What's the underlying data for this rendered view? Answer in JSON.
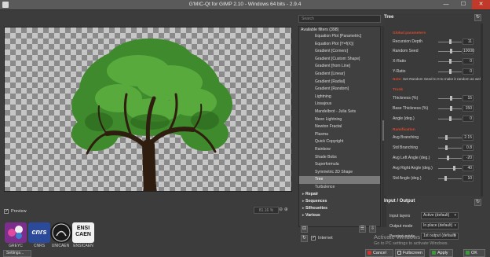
{
  "window": {
    "title": "G'MIC-Qt for GIMP 2.10 - Windows 64 bits - 2.9.4",
    "minimize": "—",
    "maximize": "☐",
    "close": "✕"
  },
  "preview": {
    "checkbox_label": "Preview",
    "checked": true,
    "zoom_value": "81.16 %",
    "zoom_buttons": "⊖ ⊕"
  },
  "logos": [
    {
      "label": "GREYC",
      "color": "#7b2e8c"
    },
    {
      "label": "CNRS",
      "color": "#2b4a9a"
    },
    {
      "label": "UNICAEN",
      "color": "#1a1a1a"
    },
    {
      "label": "ENSICAEN",
      "color": "#f2f2f2"
    }
  ],
  "logo_texts": {
    "enscaen_line1": "ENSI",
    "enscaen_line2": "CAEN",
    "cnrs": "cnrs"
  },
  "settings_button": "Settings...",
  "filters": {
    "search_placeholder": "Search",
    "header": "Available filters (398)",
    "items": [
      "Equation Plot [Parametric]",
      "Equation Plot [Y=f(X)]",
      "Gradient [Corners]",
      "Gradient [Custom Shape]",
      "Gradient [from Line]",
      "Gradient [Linear]",
      "Gradient [Radial]",
      "Gradient [Random]",
      "Lightning",
      "Lissajous",
      "Mandelbrot - Julia Sets",
      "Neon Lightning",
      "Newton Fractal",
      "Plasma",
      "Quick Copyright",
      "Rainbow",
      "Shade Bobs",
      "Superformula",
      "Symmetric 2D Shape",
      "Tree",
      "Turbulence"
    ],
    "selected": "Tree",
    "categories": [
      "Repair",
      "Sequences",
      "Silhouettes",
      "Various"
    ],
    "internet_label": "Internet",
    "internet_checked": true
  },
  "params": {
    "filter_title": "Tree",
    "sections": {
      "global": "Global parameters",
      "trunk": "Trunk",
      "ramification": "Ramification"
    },
    "rows": {
      "recursion_depth": {
        "label": "Recursion Depth",
        "value": "11",
        "level": 0.5
      },
      "random_seed": {
        "label": "Random Seed",
        "value": "10000",
        "level": 0.55
      },
      "x_ratio": {
        "label": "X-Ratio",
        "value": "0",
        "level": 0.5
      },
      "y_ratio": {
        "label": "Y-Ratio",
        "value": "0",
        "level": 0.5
      },
      "thickness": {
        "label": "Thickness (%)",
        "value": "15",
        "level": 0.55
      },
      "base_thickness": {
        "label": "Base Thickness (%)",
        "value": "150",
        "level": 0.55
      },
      "angle": {
        "label": "Angle (deg.)",
        "value": "0",
        "level": 0.5
      },
      "avg_branching": {
        "label": "Avg Branching",
        "value": "2.15",
        "level": 0.35
      },
      "std_branching": {
        "label": "Std Branching",
        "value": "0.8",
        "level": 0.35
      },
      "avg_left_angle": {
        "label": "Avg Left Angle (deg.)",
        "value": "-20",
        "level": 0.4
      },
      "avg_right_angle": {
        "label": "Avg Right Angle (deg.)",
        "value": "40",
        "level": 0.7
      },
      "std_angle": {
        "label": "Std Angle (deg.)",
        "value": "10",
        "level": 0.3
      }
    },
    "note_prefix": "Note:",
    "note_text": "Set Random Seed to 0 to make it random as well."
  },
  "io": {
    "title": "Input / Output",
    "input_layers_label": "Input layers",
    "input_layers_value": "Active (default)",
    "output_mode_label": "Output mode",
    "output_mode_value": "In place (default)",
    "preview_mode_label": "Preview mode",
    "preview_mode_value": "1st output (default)"
  },
  "watermark": {
    "line1": "Activate Windows",
    "line2": "Go to PC settings to activate Windows."
  },
  "buttons": {
    "cancel": "Cancel",
    "fullscreen": "Fullscreen",
    "apply": "Apply",
    "ok": "OK"
  },
  "colors": {
    "accent_section": "#d84a2c",
    "foliage": "#4b9a35",
    "trunk": "#2f1e10"
  }
}
